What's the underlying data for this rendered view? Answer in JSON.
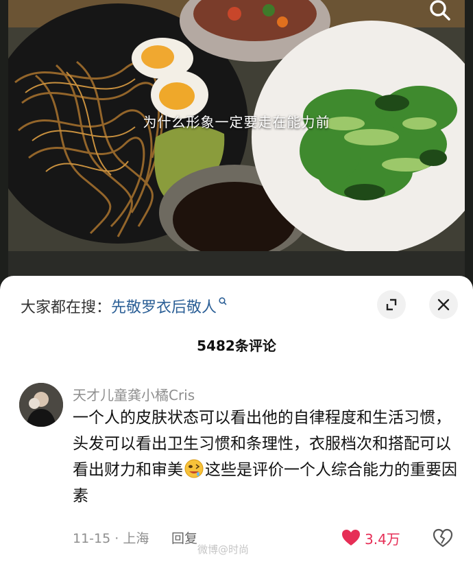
{
  "video": {
    "caption": "为什么形象一定要走在能力前"
  },
  "trending": {
    "prefix": "大家都在搜：",
    "query": "先敬罗衣后敬人"
  },
  "comments_header": {
    "count_label": "5482条评论"
  },
  "comment": {
    "username": "天才儿童龚小橘Cris",
    "text_before_emoji": "一个人的皮肤状态可以看出他的自律程度和生活习惯，头发可以看出卫生习惯和条理性，衣服档次和搭配可以看出财力和审美",
    "emoji_icon": "drooling-face-emoji",
    "text_after_emoji": "这些是评价一个人综合能力的重要因素",
    "date_location": "11-15 · 上海",
    "reply_label": "回复",
    "like_count": "3.4万"
  },
  "watermark": "微博@时尚",
  "colors": {
    "like_red": "#e62e56",
    "link_blue": "#2b5f96"
  }
}
